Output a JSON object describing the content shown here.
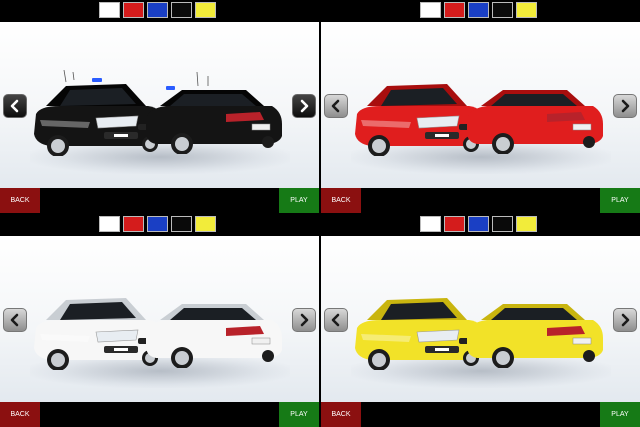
{
  "colors": {
    "swatches": [
      "#ffffff",
      "#d41c1c",
      "#1a3fc4",
      "#0a0a0a",
      "#f2ec3a"
    ],
    "back_button": "#8b1010",
    "play_button": "#167a16"
  },
  "panels": [
    {
      "car_color": "#141414",
      "car_shade": "#050505",
      "police_lights": true,
      "arrows": "dark",
      "back_label": "BACK",
      "play_label": "PLAY"
    },
    {
      "car_color": "#e01e1e",
      "car_shade": "#a80e0e",
      "police_lights": false,
      "arrows": "light",
      "back_label": "BACK",
      "play_label": "PLAY"
    },
    {
      "car_color": "#f7f7f7",
      "car_shade": "#c9ced3",
      "police_lights": false,
      "arrows": "light",
      "back_label": "BACK",
      "play_label": "PLAY"
    },
    {
      "car_color": "#f2e228",
      "car_shade": "#c9b50f",
      "police_lights": false,
      "arrows": "light",
      "back_label": "BACK",
      "play_label": "PLAY"
    }
  ],
  "icons": {
    "prev": "chevron-left-icon",
    "next": "chevron-right-icon"
  }
}
